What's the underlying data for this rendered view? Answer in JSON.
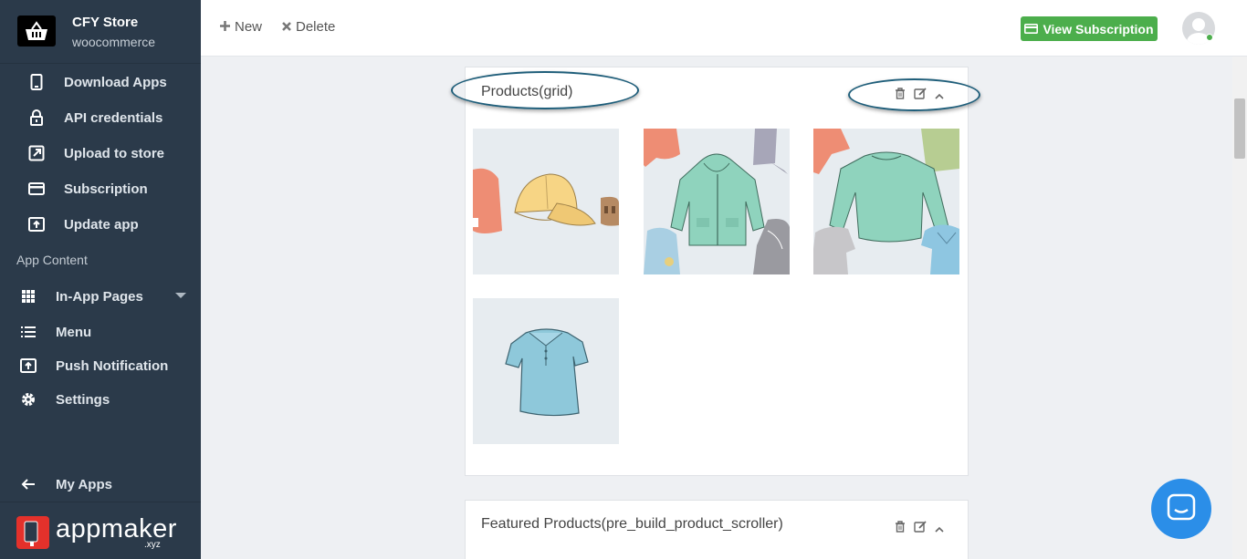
{
  "brand": {
    "name": "CFY Store",
    "subtitle": "woocommerce"
  },
  "sidebar": {
    "items": [
      {
        "label": "Download Apps",
        "icon": "phone-icon"
      },
      {
        "label": "API credentials",
        "icon": "lock-icon"
      },
      {
        "label": "Upload to store",
        "icon": "external-link-icon"
      },
      {
        "label": "Subscription",
        "icon": "credit-card-icon"
      },
      {
        "label": "Update app",
        "icon": "upload-icon"
      }
    ],
    "section_label": "App Content",
    "content_items": [
      {
        "label": "In-App Pages",
        "icon": "grid-icon"
      },
      {
        "label": "Menu",
        "icon": "list-icon"
      },
      {
        "label": "Push Notification",
        "icon": "push-icon"
      },
      {
        "label": "Settings",
        "icon": "gear-icon"
      }
    ],
    "back_label": "My Apps",
    "footer": {
      "logo_text": "appmaker",
      "logo_suffix": ".xyz"
    }
  },
  "toolbar": {
    "new_label": "New",
    "delete_label": "Delete",
    "subscription_label": "View Subscription"
  },
  "cards": [
    {
      "title": "Products(grid)",
      "images": [
        "caps and hats",
        "hoodies",
        "long sleeve shirts",
        "polo shirt"
      ]
    },
    {
      "title": "Featured Products(pre_build_product_scroller)"
    }
  ],
  "colors": {
    "sidebar": "#2b3a4a",
    "accent": "#4cae4c",
    "chat": "#2b8ee8",
    "annotation": "#1f5e7a"
  }
}
